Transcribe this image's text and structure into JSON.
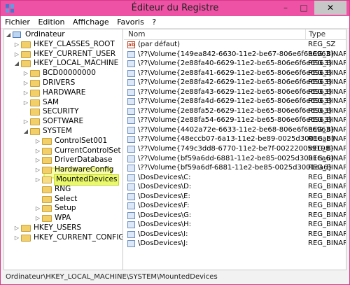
{
  "window": {
    "title": "Éditeur du Registre"
  },
  "menu": [
    "Fichier",
    "Edition",
    "Affichage",
    "Favoris",
    "?"
  ],
  "tree": [
    {
      "label": "Ordinateur",
      "level": 0,
      "expanded": true,
      "icon": "computer-icon"
    },
    {
      "label": "HKEY_CLASSES_ROOT",
      "level": 1,
      "expanded": false
    },
    {
      "label": "HKEY_CURRENT_USER",
      "level": 1,
      "expanded": false
    },
    {
      "label": "HKEY_LOCAL_MACHINE",
      "level": 1,
      "expanded": true
    },
    {
      "label": "BCD00000000",
      "level": 2,
      "expanded": false
    },
    {
      "label": "DRIVERS",
      "level": 2,
      "expanded": false
    },
    {
      "label": "HARDWARE",
      "level": 2,
      "expanded": false
    },
    {
      "label": "SAM",
      "level": 2,
      "expanded": false
    },
    {
      "label": "SECURITY",
      "level": 2,
      "expanded": null
    },
    {
      "label": "SOFTWARE",
      "level": 2,
      "expanded": false
    },
    {
      "label": "SYSTEM",
      "level": 2,
      "expanded": true
    },
    {
      "label": "ControlSet001",
      "level": 3,
      "expanded": false
    },
    {
      "label": "CurrentControlSet",
      "level": 3,
      "expanded": false
    },
    {
      "label": "DriverDatabase",
      "level": 3,
      "expanded": false
    },
    {
      "label": "HardwareConfig",
      "level": 3,
      "expanded": false
    },
    {
      "label": "MountedDevices",
      "level": 3,
      "expanded": false,
      "selected": true
    },
    {
      "label": "RNG",
      "level": 3,
      "expanded": null
    },
    {
      "label": "Select",
      "level": 3,
      "expanded": null
    },
    {
      "label": "Setup",
      "level": 3,
      "expanded": false
    },
    {
      "label": "WPA",
      "level": 3,
      "expanded": false
    },
    {
      "label": "HKEY_USERS",
      "level": 1,
      "expanded": false
    },
    {
      "label": "HKEY_CURRENT_CONFIG",
      "level": 1,
      "expanded": false
    }
  ],
  "list": {
    "headers": {
      "name": "Nom",
      "type": "Type"
    },
    "rows": [
      {
        "name": "(par défaut)",
        "type": "REG_SZ",
        "icon": "string-value-icon"
      },
      {
        "name": "\\??\\Volume{149ea842-6630-11e2-be67-806e6f6e6963}",
        "type": "REG_BINARY",
        "icon": "binary-value-icon"
      },
      {
        "name": "\\??\\Volume{2e88fa40-6629-11e2-be65-806e6f6e6963}",
        "type": "REG_BINARY",
        "icon": "binary-value-icon"
      },
      {
        "name": "\\??\\Volume{2e88fa41-6629-11e2-be65-806e6f6e6963}",
        "type": "REG_BINARY",
        "icon": "binary-value-icon"
      },
      {
        "name": "\\??\\Volume{2e88fa42-6629-11e2-be65-806e6f6e6963}",
        "type": "REG_BINARY",
        "icon": "binary-value-icon"
      },
      {
        "name": "\\??\\Volume{2e88fa43-6629-11e2-be65-806e6f6e6963}",
        "type": "REG_BINARY",
        "icon": "binary-value-icon"
      },
      {
        "name": "\\??\\Volume{2e88fa4d-6629-11e2-be65-806e6f6e6963}",
        "type": "REG_BINARY",
        "icon": "binary-value-icon"
      },
      {
        "name": "\\??\\Volume{2e88fa52-6629-11e2-be65-806e6f6e6963}",
        "type": "REG_BINARY",
        "icon": "binary-value-icon"
      },
      {
        "name": "\\??\\Volume{2e88fa54-6629-11e2-be65-806e6f6e6963}",
        "type": "REG_BINARY",
        "icon": "binary-value-icon"
      },
      {
        "name": "\\??\\Volume{4402a72e-6633-11e2-be68-806e6f6e6963}",
        "type": "REG_BINARY",
        "icon": "binary-value-icon"
      },
      {
        "name": "\\??\\Volume{48eccb07-6a13-11e2-be89-0025d3001ea6}",
        "type": "REG_BINARY",
        "icon": "binary-value-icon"
      },
      {
        "name": "\\??\\Volume{749c3dd8-6770-11e2-be7f-002220059198}",
        "type": "REG_BINARY",
        "icon": "binary-value-icon"
      },
      {
        "name": "\\??\\Volume{bf59a6dd-6881-11e2-be85-0025d3001ea6}",
        "type": "REG_BINARY",
        "icon": "binary-value-icon"
      },
      {
        "name": "\\??\\Volume{bf59a6df-6881-11e2-be85-0025d3001ea6}",
        "type": "REG_BINARY",
        "icon": "binary-value-icon"
      },
      {
        "name": "\\DosDevices\\C:",
        "type": "REG_BINARY",
        "icon": "binary-value-icon"
      },
      {
        "name": "\\DosDevices\\D:",
        "type": "REG_BINARY",
        "icon": "binary-value-icon"
      },
      {
        "name": "\\DosDevices\\E:",
        "type": "REG_BINARY",
        "icon": "binary-value-icon"
      },
      {
        "name": "\\DosDevices\\F:",
        "type": "REG_BINARY",
        "icon": "binary-value-icon"
      },
      {
        "name": "\\DosDevices\\G:",
        "type": "REG_BINARY",
        "icon": "binary-value-icon"
      },
      {
        "name": "\\DosDevices\\H:",
        "type": "REG_BINARY",
        "icon": "binary-value-icon"
      },
      {
        "name": "\\DosDevices\\I:",
        "type": "REG_BINARY",
        "icon": "binary-value-icon"
      },
      {
        "name": "\\DosDevices\\J:",
        "type": "REG_BINARY",
        "icon": "binary-value-icon"
      }
    ]
  },
  "status": {
    "path": "Ordinateur\\HKEY_LOCAL_MACHINE\\SYSTEM\\MountedDevices"
  },
  "colors": {
    "titlebar": "#ee52a4",
    "highlight": "#e9f96a"
  }
}
